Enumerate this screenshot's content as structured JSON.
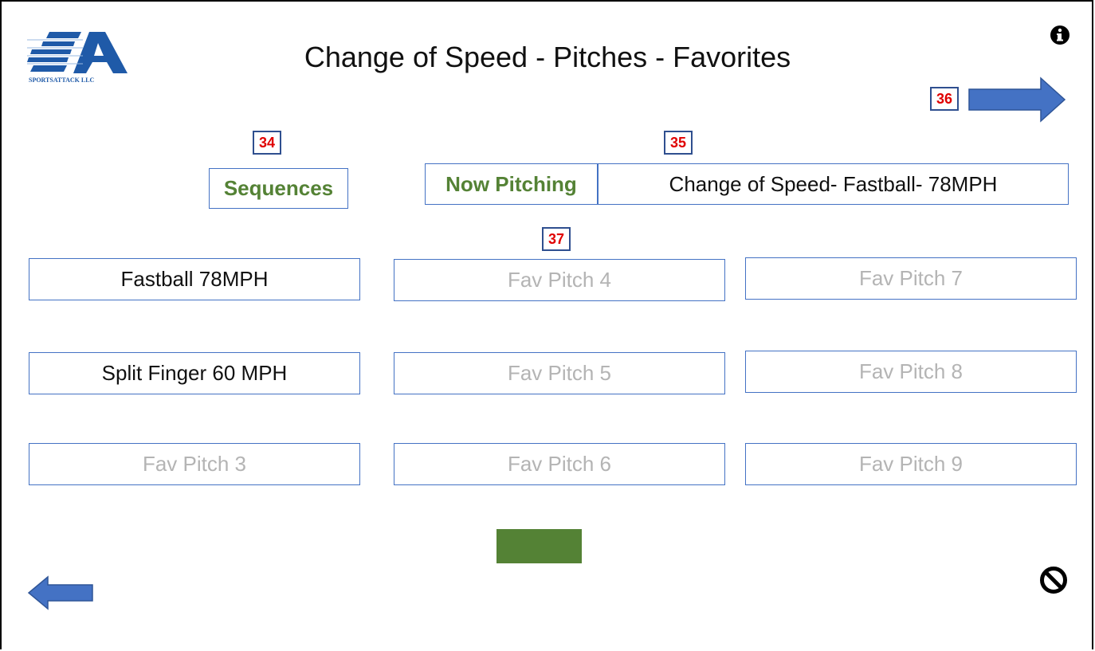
{
  "title": "Change of Speed - Pitches - Favorites",
  "logo_text": "SPORTSATTACK LLC",
  "icons": {
    "info": "info-icon",
    "cancel": "ban-icon",
    "next": "arrow-right-icon",
    "back": "arrow-left-icon"
  },
  "badges": {
    "sequences": "34",
    "now_pitching": "35",
    "next": "36",
    "favorites": "37"
  },
  "sequences_label": "Sequences",
  "now_pitching": {
    "label": "Now Pitching",
    "value": "Change of Speed- Fastball- 78MPH"
  },
  "pitches": [
    {
      "label": "Fastball 78MPH",
      "state": "set"
    },
    {
      "label": "Split Finger 60 MPH",
      "state": "set"
    },
    {
      "label": "Fav Pitch 3",
      "state": "empty"
    },
    {
      "label": "Fav Pitch 4",
      "state": "empty"
    },
    {
      "label": "Fav Pitch 5",
      "state": "empty"
    },
    {
      "label": "Fav Pitch 6",
      "state": "empty"
    },
    {
      "label": "Fav Pitch 7",
      "state": "empty"
    },
    {
      "label": "Fav Pitch 8",
      "state": "empty"
    },
    {
      "label": "Fav Pitch 9",
      "state": "empty"
    }
  ],
  "colors": {
    "accent_green": "#548235",
    "border_blue": "#4472c4",
    "badge_red": "#e00000",
    "arrow_blue": "#4472c4",
    "empty_text": "#b4b4b4"
  }
}
